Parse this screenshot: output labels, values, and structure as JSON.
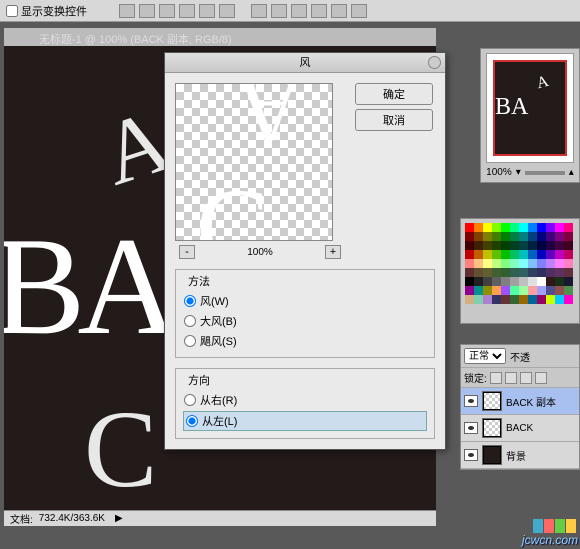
{
  "topbar": {
    "checkbox_label": "显示变换控件"
  },
  "doc": {
    "title": "无标题-1 @ 100% (BACK 副本, RGB/8)",
    "canvas_text": "BA",
    "status_label": "文档:",
    "status_value": "732.4K/363.6K"
  },
  "navigator": {
    "thumb_text": "BA",
    "zoom": "100%"
  },
  "layers": {
    "blend_mode": "正常",
    "opacity_label": "不透",
    "lock_label": "锁定:",
    "items": [
      {
        "name": "BACK 副本",
        "thumb": "trans",
        "selected": true
      },
      {
        "name": "BACK",
        "thumb": "trans",
        "selected": false
      },
      {
        "name": "背景",
        "thumb": "solid",
        "selected": false
      }
    ]
  },
  "dialog": {
    "title": "风",
    "ok": "确定",
    "cancel": "取消",
    "preview_zoom": "100%",
    "method_legend": "方法",
    "methods": [
      {
        "label": "风(W)",
        "value": "wind",
        "checked": true
      },
      {
        "label": "大风(B)",
        "value": "blast",
        "checked": false
      },
      {
        "label": "飓风(S)",
        "value": "stagger",
        "checked": false
      }
    ],
    "direction_legend": "方向",
    "directions": [
      {
        "label": "从右(R)",
        "value": "right",
        "checked": false
      },
      {
        "label": "从左(L)",
        "value": "left",
        "checked": true
      }
    ]
  },
  "watermark": "jcwcn.com",
  "swatch_colors": [
    "#ff0000",
    "#ff8000",
    "#ffff00",
    "#80ff00",
    "#00ff00",
    "#00ff80",
    "#00ffff",
    "#0080ff",
    "#0000ff",
    "#8000ff",
    "#ff00ff",
    "#ff0080",
    "#800000",
    "#804000",
    "#808000",
    "#408000",
    "#008000",
    "#008040",
    "#008080",
    "#004080",
    "#000080",
    "#400080",
    "#800080",
    "#800040",
    "#400000",
    "#402000",
    "#404000",
    "#204000",
    "#004000",
    "#004020",
    "#004040",
    "#002040",
    "#000040",
    "#200040",
    "#400040",
    "#400020",
    "#c00000",
    "#c06000",
    "#c0c000",
    "#60c000",
    "#00c000",
    "#00c060",
    "#00c0c0",
    "#0060c0",
    "#0000c0",
    "#6000c0",
    "#c000c0",
    "#c00060",
    "#ff8080",
    "#ffc080",
    "#ffff80",
    "#c0ff80",
    "#80ff80",
    "#80ffc0",
    "#80ffff",
    "#80c0ff",
    "#8080ff",
    "#c080ff",
    "#ff80ff",
    "#ff80c0",
    "#603030",
    "#605030",
    "#606030",
    "#406030",
    "#306030",
    "#306050",
    "#306060",
    "#304060",
    "#303060",
    "#503060",
    "#603060",
    "#603040",
    "#000000",
    "#202020",
    "#404040",
    "#606060",
    "#808080",
    "#a0a0a0",
    "#c0c0c0",
    "#e0e0e0",
    "#ffffff",
    "#301818",
    "#183018",
    "#181830",
    "#900090",
    "#009090",
    "#909000",
    "#ffa050",
    "#a050ff",
    "#50ffa0",
    "#a0ffa0",
    "#ffa0a0",
    "#a0a0ff",
    "#505090",
    "#905050",
    "#509050",
    "#d0b080",
    "#80d0b0",
    "#b080d0",
    "#333366",
    "#663333",
    "#336633",
    "#996600",
    "#006699",
    "#990066",
    "#ccff00",
    "#00ccff",
    "#ff00cc"
  ]
}
